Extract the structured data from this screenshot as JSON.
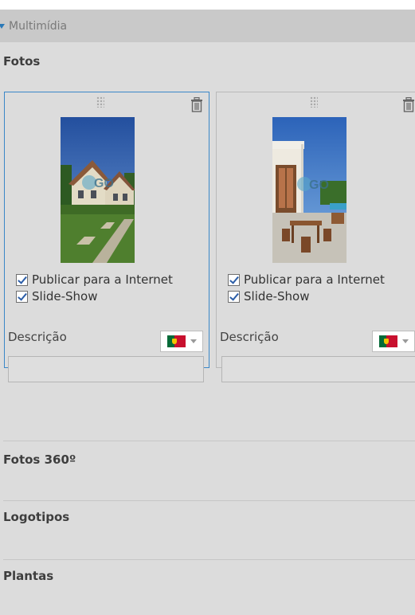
{
  "section": {
    "title": "Multimídia",
    "icon": "caret-down-icon"
  },
  "groups": {
    "fotos": "Fotos",
    "fotos360": "Fotos 360º",
    "logotipos": "Logotipos",
    "plantas": "Plantas"
  },
  "photos": [
    {
      "publish_label": "Publicar para a Internet",
      "publish_checked": true,
      "slideshow_label": "Slide-Show",
      "slideshow_checked": true,
      "description_label": "Descrição",
      "description_value": "",
      "language_flag": "portugal-flag-icon",
      "watermark": "GO"
    },
    {
      "publish_label": "Publicar para a Internet",
      "publish_checked": true,
      "slideshow_label": "Slide-Show",
      "slideshow_checked": true,
      "description_label": "Descrição",
      "description_value": "",
      "language_flag": "portugal-flag-icon",
      "watermark": "GO"
    }
  ],
  "colors": {
    "background": "#dcdcdc",
    "header": "#c9c9c9",
    "selected_border": "#3a87c8",
    "accent": "#2a79b8"
  }
}
